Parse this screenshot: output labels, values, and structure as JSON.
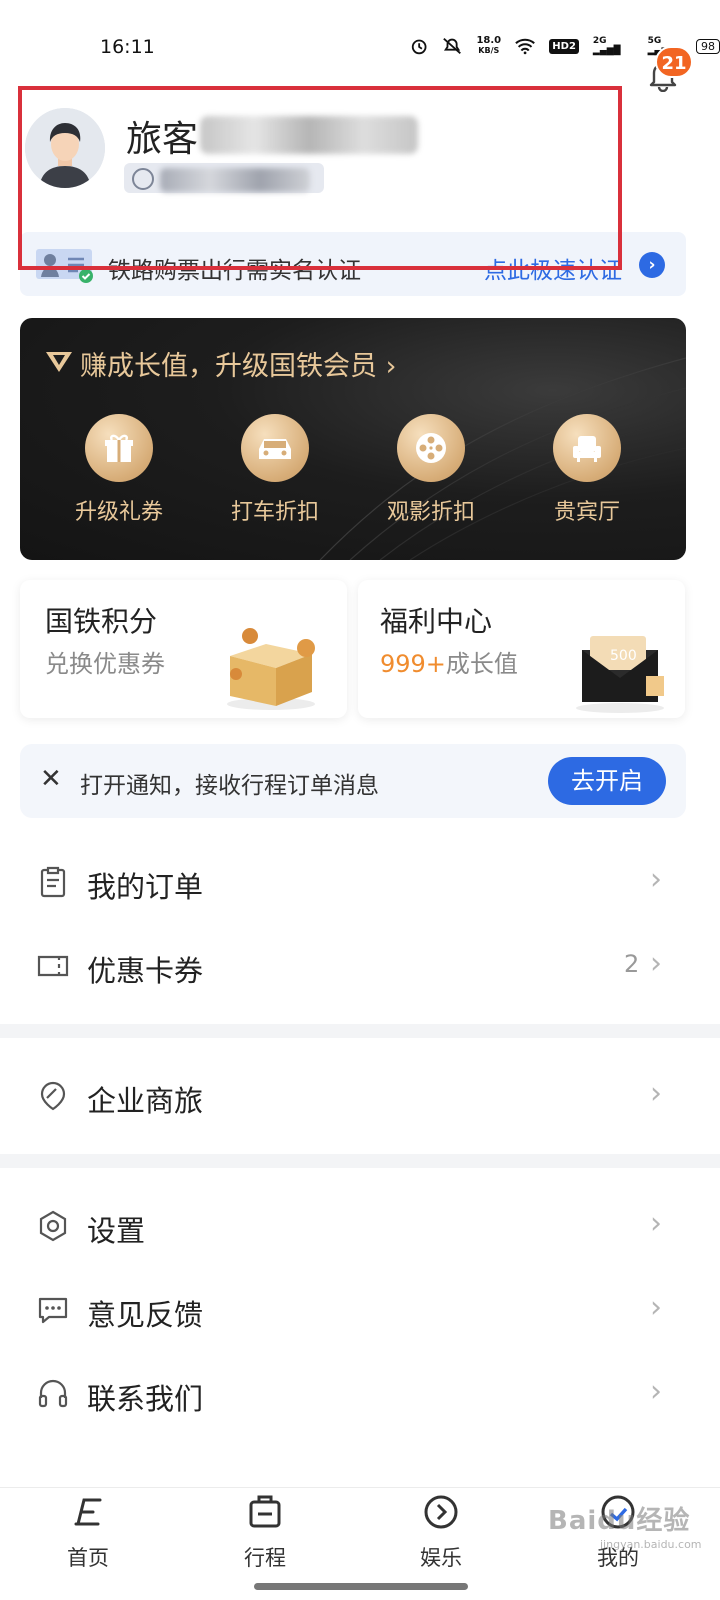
{
  "status_bar": {
    "time": "16:11",
    "speed_top": "18.0",
    "speed_unit": "KB/S",
    "hd": "HD2",
    "net1": "2G",
    "net2": "5G",
    "battery": "98"
  },
  "header": {
    "bell_badge": "21"
  },
  "profile": {
    "name_label": "旅客"
  },
  "verify": {
    "text": "铁路购票出行需实名认证",
    "link": "点此极速认证"
  },
  "member": {
    "title": "赚成长值，升级国铁会员 ›",
    "perks": [
      {
        "label": "升级礼券",
        "icon": "gift-icon"
      },
      {
        "label": "打车折扣",
        "icon": "car-icon"
      },
      {
        "label": "观影折扣",
        "icon": "film-reel-icon"
      },
      {
        "label": "贵宾厅",
        "icon": "armchair-icon"
      }
    ]
  },
  "points_card": {
    "title": "国铁积分",
    "subtitle": "兑换优惠券"
  },
  "welfare_card": {
    "title": "福利中心",
    "value": "999+",
    "suffix": "成长值",
    "badge": "500"
  },
  "notify": {
    "text": "打开通知，接收行程订单消息",
    "button": "去开启"
  },
  "menu": {
    "orders": "我的订单",
    "coupons": "优惠卡券",
    "coupons_count": "2",
    "business": "企业商旅",
    "settings": "设置",
    "feedback": "意见反馈",
    "contact": "联系我们"
  },
  "tabs": {
    "home": "首页",
    "trips": "行程",
    "entertainment": "娱乐",
    "mine": "我的"
  },
  "watermark": {
    "main": "Baidu经验",
    "sub": "jingyan.baidu.com"
  },
  "colors": {
    "accent_blue": "#2d6ae3",
    "gold": "#e8c89a",
    "badge_orange": "#f26522",
    "highlight_red": "#d9303b"
  }
}
